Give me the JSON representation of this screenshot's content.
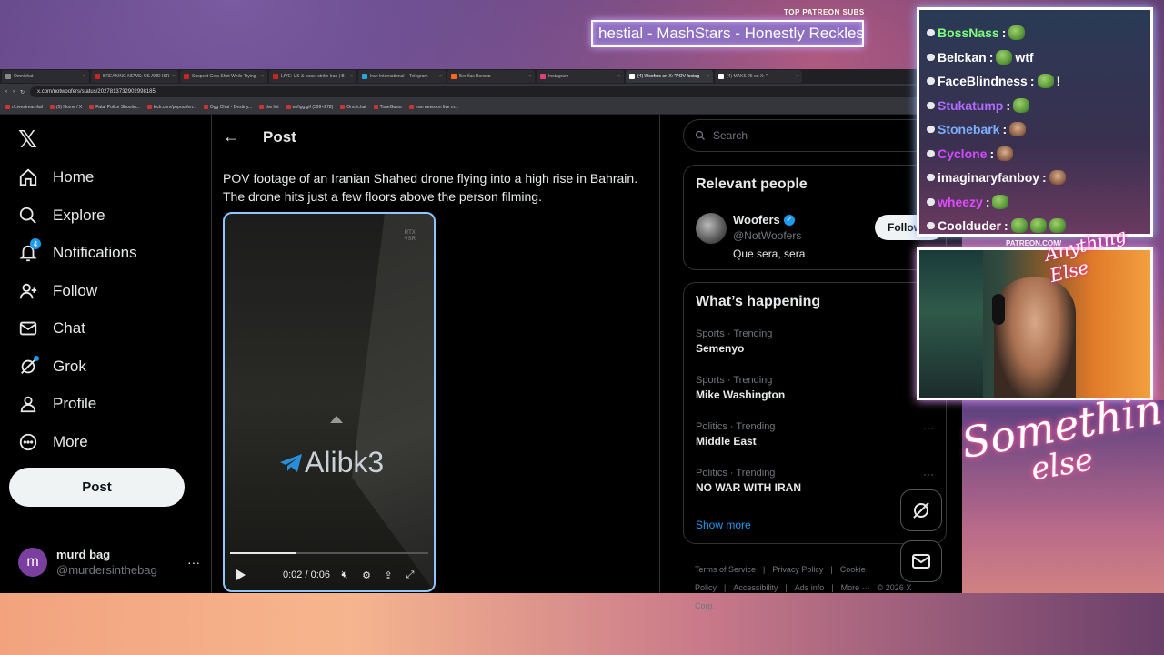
{
  "browser": {
    "tabs": [
      {
        "label": "Omnichat",
        "color": "#888888"
      },
      {
        "label": "BREAKING NEWS: US AND ISR",
        "color": "#cc2222"
      },
      {
        "label": "Suspect Gets Shot While Trying",
        "color": "#cc2222"
      },
      {
        "label": "LIVE: US & Israel strike Iran | B",
        "color": "#cc2222"
      },
      {
        "label": "Iran International – Telegram",
        "color": "#2aa3e0"
      },
      {
        "label": "Бенбак Волков",
        "color": "#ff6622"
      },
      {
        "label": "Instagram",
        "color": "#e0407a"
      },
      {
        "label": "(4) Woofers on X: \"POV footag",
        "color": "#ffffff"
      },
      {
        "label": "(4) MAKS 25 on X: \"",
        "color": "#ffffff"
      }
    ],
    "url": "x.com/notwoofers/status/2027813732902998185",
    "bookmarks": [
      "r/Livestreamfail",
      "(5) Home / X",
      "Fatal Police Shootin...",
      "kick.com/popout/en...",
      "Dgg Chat - Destiny...",
      "the list",
      "enfigg.gif (399×278)",
      "Omnichat",
      "TimeGuesr",
      "iran news on live m..."
    ]
  },
  "nav": {
    "logo": "𝕏",
    "items": [
      {
        "label": "Home"
      },
      {
        "label": "Explore"
      },
      {
        "label": "Notifications",
        "badge": "4"
      },
      {
        "label": "Follow"
      },
      {
        "label": "Chat"
      },
      {
        "label": "Grok"
      },
      {
        "label": "Profile"
      },
      {
        "label": "More"
      }
    ],
    "post_button": "Post",
    "account": {
      "initial": "m",
      "name": "murd bag",
      "handle": "@murdersinthebag",
      "more": "···"
    }
  },
  "main": {
    "title": "Post",
    "back": "←",
    "text": "POV footage of an Iranian Shahed drone flying into a high rise in Bahrain. The drone hits just a few floors above the person filming.",
    "video": {
      "watermark": "Alibk3",
      "rtx_label": "RTX",
      "vsr_label": "VSR",
      "time": "0:02 / 0:06",
      "progress": 0.33
    }
  },
  "right": {
    "search_placeholder": "Search",
    "relevant_title": "Relevant people",
    "person": {
      "name": "Woofers",
      "handle": "@NotWoofers",
      "bio": "Que sera, sera",
      "follow_label": "Follow"
    },
    "happening_title": "What’s happening",
    "trends": [
      {
        "category": "Sports · Trending",
        "topic": "Semenyo"
      },
      {
        "category": "Sports · Trending",
        "topic": "Mike Washington"
      },
      {
        "category": "Politics · Trending",
        "topic": "Middle East"
      },
      {
        "category": "Politics · Trending",
        "topic": "NO WAR WITH IRAN"
      }
    ],
    "show_more": "Show more",
    "footer": [
      "Terms of Service",
      "|",
      "Privacy Policy",
      "|",
      "Cookie Policy",
      "|",
      "Accessibility",
      "|",
      "Ads info",
      "|",
      "More ···",
      "© 2026 X Corp."
    ]
  },
  "overlay": {
    "patreon_title": "TOP PATREON SUBS",
    "patreon_scroll": "hestial - MashStars - Honestly Reckless",
    "chat": [
      {
        "user": "BossNass",
        "color": "#7cff7c",
        "msg": "",
        "emotes": [
          "frog"
        ]
      },
      {
        "user": "Belckan",
        "color": "#ffffff",
        "msg": "wtf",
        "emotes": [
          "frog"
        ]
      },
      {
        "user": "FaceBlindness",
        "color": "#ffffff",
        "msg": "!",
        "emotes": [
          "frog"
        ]
      },
      {
        "user": "Stukatump",
        "color": "#b06aff",
        "msg": "",
        "emotes": [
          "frog"
        ]
      },
      {
        "user": "Stonebark",
        "color": "#7ab0ff",
        "msg": "",
        "emotes": [
          "face"
        ]
      },
      {
        "user": "Cyclone",
        "color": "#d04aff",
        "msg": "",
        "emotes": [
          "face"
        ]
      },
      {
        "user": "imaginaryfanboy",
        "color": "#ffffff",
        "msg": "",
        "emotes": [
          "face"
        ]
      },
      {
        "user": "wheezy",
        "color": "#e04aff",
        "msg": "",
        "emotes": [
          "frog"
        ]
      },
      {
        "user": "Coolduder",
        "color": "#ffffff",
        "msg": "",
        "emotes": [
          "frog",
          "frog",
          "frog"
        ]
      }
    ],
    "patreon_url": "PATREON.COM/",
    "sig_top": "Anything Else",
    "sig_big_1": "Something",
    "sig_big_2": "else"
  }
}
